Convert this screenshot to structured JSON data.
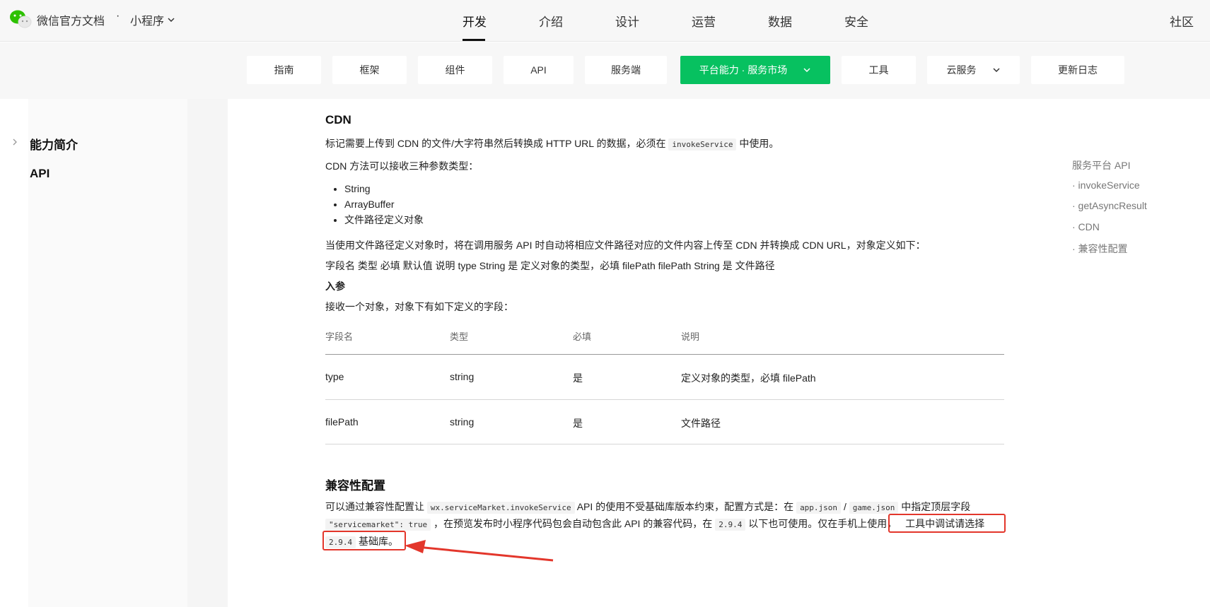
{
  "header": {
    "brand": "微信官方文档",
    "dot": "·",
    "product": "小程序",
    "tabs": [
      "开发",
      "介绍",
      "设计",
      "运营",
      "数据",
      "安全"
    ],
    "community": "社区"
  },
  "subnav": {
    "items": [
      "指南",
      "框架",
      "组件",
      "API",
      "服务端",
      "平台能力 · 服务市场",
      "工具",
      "云服务",
      "更新日志"
    ],
    "active_color": "#07c160"
  },
  "sidebar": {
    "items": [
      "能力简介",
      "API"
    ]
  },
  "content": {
    "cdn_title": "CDN",
    "cdn_p1_a": "标记需要上传到 CDN 的文件/大字符串然后转换成 HTTP URL 的数据，必须在",
    "cdn_p1_code": "invokeService",
    "cdn_p1_b": "中使用。",
    "cdn_p2": "CDN 方法可以接收三种参数类型：",
    "cdn_types": [
      "String",
      "ArrayBuffer",
      "文件路径定义对象"
    ],
    "cdn_p3": "当使用文件路径定义对象时，将在调用服务 API 时自动将相应文件路径对应的文件内容上传至 CDN 并转换成 CDN URL，对象定义如下：",
    "cdn_p4": "字段名 类型 必填 默认值 说明 type String 是 定义对象的类型，必填 filePath filePath String 是 文件路径",
    "params_title": "入参",
    "params_desc": "接收一个对象，对象下有如下定义的字段：",
    "table": {
      "headers": [
        "字段名",
        "类型",
        "必填",
        "说明"
      ],
      "rows": [
        [
          "type",
          "string",
          "是",
          "定义对象的类型，必填 filePath"
        ],
        [
          "filePath",
          "string",
          "是",
          "文件路径"
        ]
      ]
    },
    "compat_title": "兼容性配置",
    "compat_a": "可以通过兼容性配置让",
    "compat_code1": "wx.serviceMarket.invokeService",
    "compat_b": "API 的使用不受基础库版本约束，配置方式是：在",
    "compat_code2": "app.json",
    "compat_c": "/",
    "compat_code3": "game.json",
    "compat_d": "中指定顶层字段",
    "compat_code4": "\"servicemarket\": true",
    "compat_e": "，在预览发布时小程序代码包会自动包含此 API 的兼容代码，在",
    "compat_code5": "2.9.4",
    "compat_f": "以下也可使用。仅在手机上使用，",
    "compat_g": "工具中调试请选择",
    "compat_code6": "2.9.4",
    "compat_h": "基础库。",
    "annotation_color": "#e3362b"
  },
  "toc": {
    "items": [
      "服务平台 API",
      "· invokeService",
      "· getAsyncResult",
      "· CDN",
      "· 兼容性配置"
    ]
  }
}
